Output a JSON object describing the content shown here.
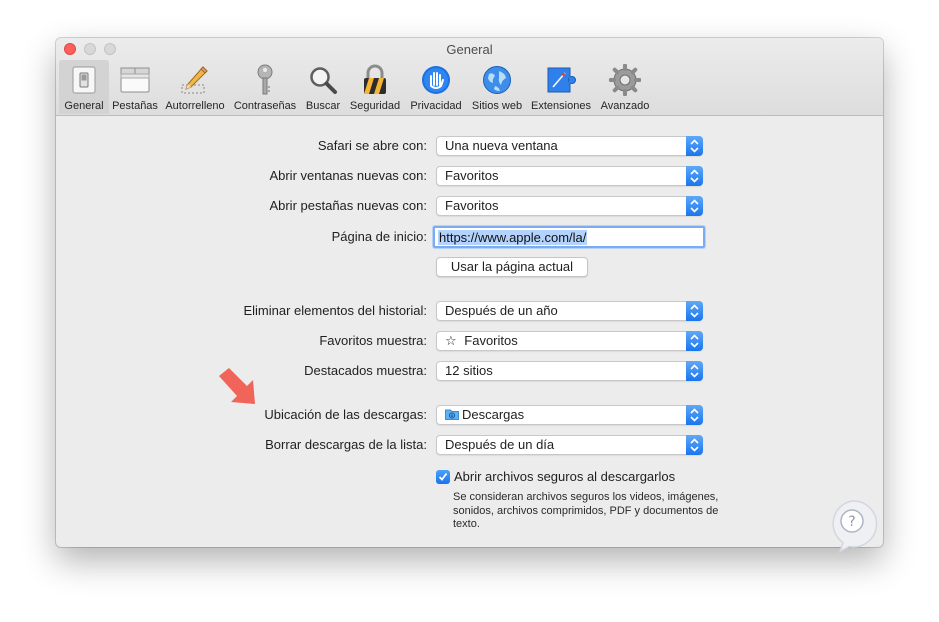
{
  "window": {
    "title": "General"
  },
  "toolbar": {
    "items": [
      {
        "label": "General",
        "icon": "general-switch-icon",
        "selected": true
      },
      {
        "label": "Pestañas",
        "icon": "tabs-window-icon"
      },
      {
        "label": "Autorrelleno",
        "icon": "pencil-icon"
      },
      {
        "label": "Contraseñas",
        "icon": "key-icon"
      },
      {
        "label": "Buscar",
        "icon": "magnifier-icon"
      },
      {
        "label": "Seguridad",
        "icon": "padlock-icon"
      },
      {
        "label": "Privacidad",
        "icon": "hand-icon"
      },
      {
        "label": "Sitios web",
        "icon": "globe-icon"
      },
      {
        "label": "Extensiones",
        "icon": "puzzle-icon"
      },
      {
        "label": "Avanzado",
        "icon": "gear-icon"
      }
    ]
  },
  "settings": {
    "opens_with": {
      "label": "Safari se abre con:",
      "value": "Una nueva ventana"
    },
    "new_windows": {
      "label": "Abrir ventanas nuevas con:",
      "value": "Favoritos"
    },
    "new_tabs": {
      "label": "Abrir pestañas nuevas con:",
      "value": "Favoritos"
    },
    "homepage": {
      "label": "Página de inicio:",
      "value": "https://www.apple.com/la/"
    },
    "use_current_button": "Usar la página actual",
    "remove_history": {
      "label": "Eliminar elementos del historial:",
      "value": "Después de un año"
    },
    "favorites_shows": {
      "label": "Favoritos muestra:",
      "value": "Favoritos",
      "prefix": "☆"
    },
    "top_sites": {
      "label": "Destacados muestra:",
      "value": "12 sitios"
    },
    "download_location": {
      "label": "Ubicación de las descargas:",
      "value": "Descargas"
    },
    "remove_downloads": {
      "label": "Borrar descargas de la lista:",
      "value": "Después de un día"
    },
    "open_safe_files": {
      "label": "Abrir archivos seguros al descargarlos",
      "checked": true,
      "note": "Se consideran archivos seguros los videos, imágenes, sonidos, archivos comprimidos, PDF y documentos de texto."
    }
  },
  "colors": {
    "accent": "#1a76ee",
    "annotation_arrow": "#f0645a",
    "close_button": "#fc605c"
  }
}
